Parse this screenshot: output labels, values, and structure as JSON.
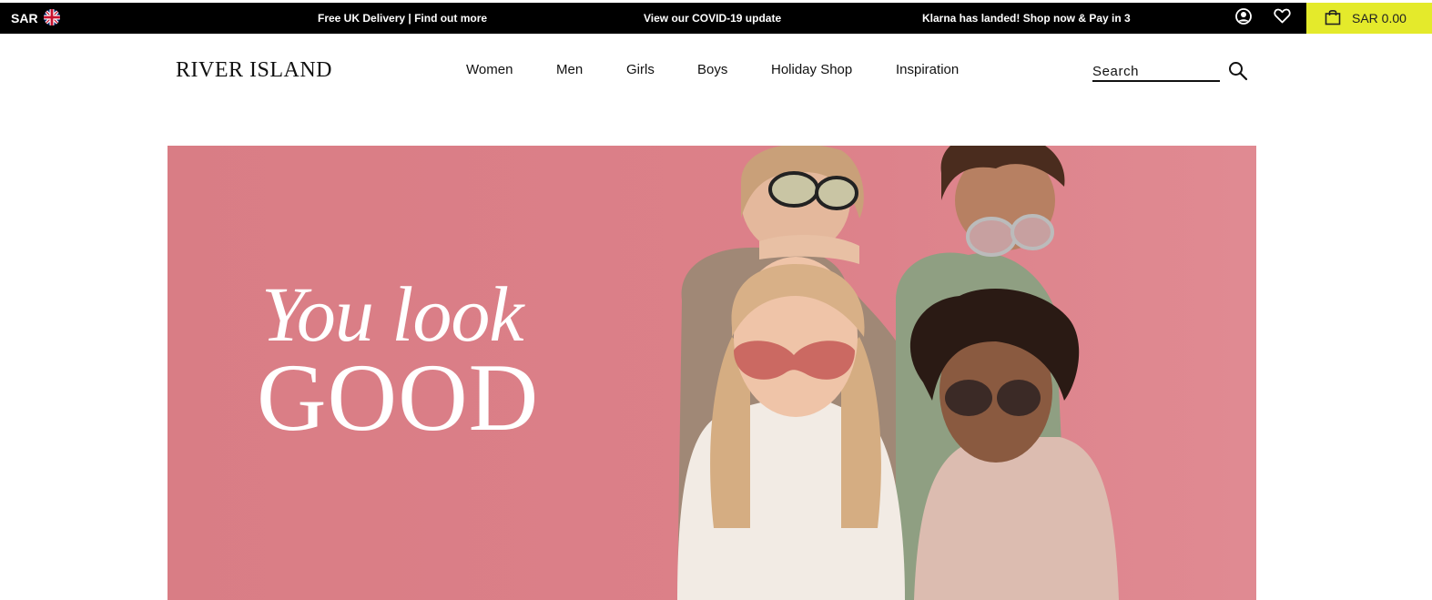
{
  "topbar": {
    "currency": "SAR",
    "flag_icon": "uk-flag-icon",
    "promos": [
      "Free UK Delivery | Find out more",
      "View our COVID-19 update",
      "Klarna has landed! Shop now & Pay in 3"
    ],
    "account_icon": "account-icon",
    "wishlist_icon": "heart-icon",
    "basket_icon": "shopping-bag-icon",
    "basket_total": "SAR 0.00",
    "basket_color": "#e4ea2b"
  },
  "header": {
    "logo": "RIVER ISLAND",
    "nav": [
      "Women",
      "Men",
      "Girls",
      "Boys",
      "Holiday Shop",
      "Inspiration"
    ],
    "search_placeholder": "Search",
    "search_icon": "search-icon"
  },
  "hero": {
    "line_1": "You look",
    "line_2": "GOOD",
    "background_color": "#dc8089"
  }
}
